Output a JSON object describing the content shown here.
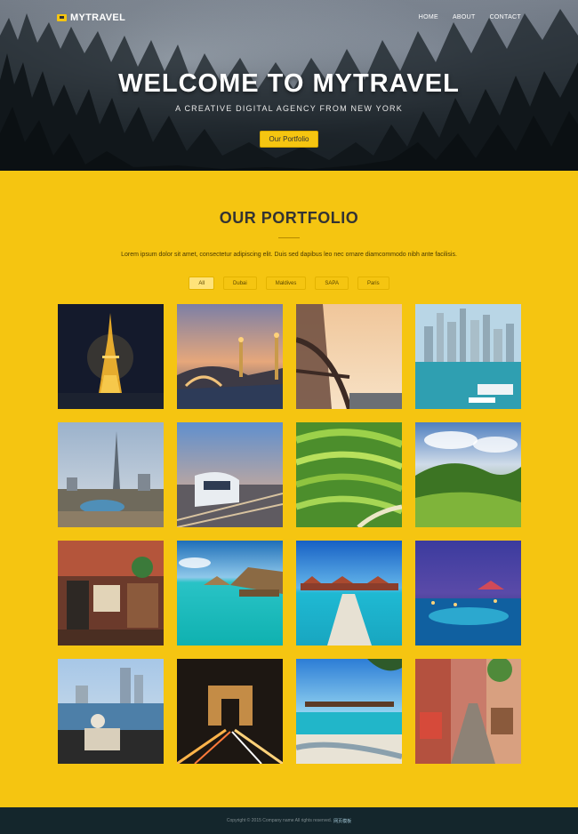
{
  "nav": {
    "logo": "MYTRAVEL",
    "links": [
      "HOME",
      "ABOUT",
      "CONTACT"
    ]
  },
  "hero": {
    "title": "WELCOME TO MYTRAVEL",
    "subtitle": "A CREATIVE DIGITAL AGENCY FROM NEW YORK",
    "button": "Our Portfolio"
  },
  "portfolio": {
    "title_light": "OUR ",
    "title_bold": "PORTFOLIO",
    "description": "Lorem ipsum dolor sit amet, consectetur adipiscing elit. Duis sed dapibus leo nec ornare diamcommodo nibh ante facilisis.",
    "filters": [
      "All",
      "Dubai",
      "Maldives",
      "SAPA",
      "Paris"
    ],
    "active_filter": "All"
  },
  "footer": {
    "copyright": "Copyright © 2015 Company name All rights reserved.",
    "link": "网页模板"
  },
  "colors": {
    "accent": "#f5c511",
    "footer_bg": "#14262c"
  }
}
